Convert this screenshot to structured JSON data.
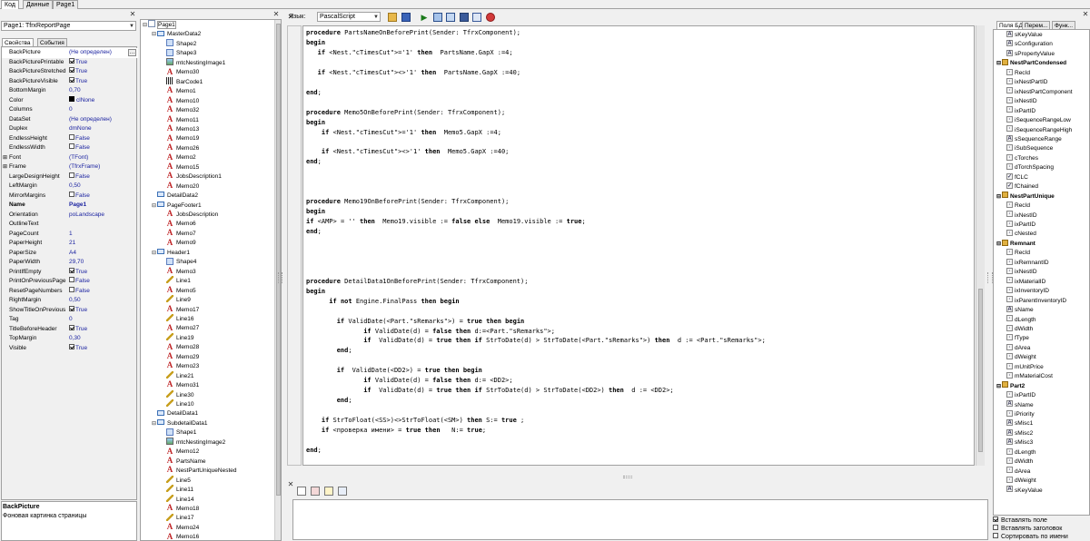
{
  "top_tabs": [
    "Код",
    "Данные",
    "Page1"
  ],
  "object_combo": "Page1: TfrxReportPage",
  "inspector_tabs": [
    "Свойства",
    "События"
  ],
  "properties": [
    {
      "name": "BackPicture",
      "value": "(Не определен)",
      "has_btn": true
    },
    {
      "name": "BackPicturePrintable",
      "value": "True",
      "check": true
    },
    {
      "name": "BackPictureStretched",
      "value": "True",
      "check": true
    },
    {
      "name": "BackPictureVisible",
      "value": "True",
      "check": true
    },
    {
      "name": "BottomMargin",
      "value": "0,70"
    },
    {
      "name": "Color",
      "value": "clNone",
      "swatch": "#000000"
    },
    {
      "name": "Columns",
      "value": "0"
    },
    {
      "name": "DataSet",
      "value": "(Не определен)"
    },
    {
      "name": "Duplex",
      "value": "dmNone"
    },
    {
      "name": "EndlessHeight",
      "value": "False",
      "check": false
    },
    {
      "name": "EndlessWidth",
      "value": "False",
      "check": false
    },
    {
      "name": "Font",
      "value": "(TFont)",
      "plus": true
    },
    {
      "name": "Frame",
      "value": "(TfrxFrame)",
      "plus": true
    },
    {
      "name": "LargeDesignHeight",
      "value": "False",
      "check": false
    },
    {
      "name": "LeftMargin",
      "value": "0,50"
    },
    {
      "name": "MirrorMargins",
      "value": "False",
      "check": false
    },
    {
      "name": "Name",
      "value": "Page1",
      "bold": true
    },
    {
      "name": "Orientation",
      "value": "poLandscape"
    },
    {
      "name": "OutlineText",
      "value": ""
    },
    {
      "name": "PageCount",
      "value": "1"
    },
    {
      "name": "PaperHeight",
      "value": "21"
    },
    {
      "name": "PaperSize",
      "value": "A4"
    },
    {
      "name": "PaperWidth",
      "value": "29,70"
    },
    {
      "name": "PrintIfEmpty",
      "value": "True",
      "check": true
    },
    {
      "name": "PrintOnPreviousPage",
      "value": "False",
      "check": false
    },
    {
      "name": "ResetPageNumbers",
      "value": "False",
      "check": false
    },
    {
      "name": "RightMargin",
      "value": "0,50"
    },
    {
      "name": "ShowTitleOnPrevious",
      "value": "True",
      "check": true
    },
    {
      "name": "Tag",
      "value": "0"
    },
    {
      "name": "TitleBeforeHeader",
      "value": "True",
      "check": true
    },
    {
      "name": "TopMargin",
      "value": "0,30"
    },
    {
      "name": "Visible",
      "value": "True",
      "check": true
    }
  ],
  "prop_hint": {
    "title": "BackPicture",
    "desc": "Фоновая картинка страницы"
  },
  "tree": [
    {
      "label": "Page1",
      "icon": "page",
      "level": 0,
      "exp": "-"
    },
    {
      "label": "MasterData2",
      "icon": "band",
      "level": 1,
      "exp": "-"
    },
    {
      "label": "Shape2",
      "icon": "shape",
      "level": 2
    },
    {
      "label": "Shape3",
      "icon": "shape",
      "level": 2
    },
    {
      "label": "mtcNestingImage1",
      "icon": "pic",
      "level": 2
    },
    {
      "label": "Memo30",
      "icon": "memo",
      "level": 2
    },
    {
      "label": "BarCode1",
      "icon": "bar",
      "level": 2
    },
    {
      "label": "Memo1",
      "icon": "memo",
      "level": 2
    },
    {
      "label": "Memo10",
      "icon": "memo",
      "level": 2
    },
    {
      "label": "Memo32",
      "icon": "memo",
      "level": 2
    },
    {
      "label": "Memo11",
      "icon": "memo",
      "level": 2
    },
    {
      "label": "Memo13",
      "icon": "memo",
      "level": 2
    },
    {
      "label": "Memo19",
      "icon": "memo",
      "level": 2
    },
    {
      "label": "Memo26",
      "icon": "memo",
      "level": 2
    },
    {
      "label": "Memo2",
      "icon": "memo",
      "level": 2
    },
    {
      "label": "Memo15",
      "icon": "memo",
      "level": 2
    },
    {
      "label": "JobsDescription1",
      "icon": "memo",
      "level": 2
    },
    {
      "label": "Memo20",
      "icon": "memo",
      "level": 2
    },
    {
      "label": "DetailData2",
      "icon": "band",
      "level": 1
    },
    {
      "label": "PageFooter1",
      "icon": "band",
      "level": 1,
      "exp": "-"
    },
    {
      "label": "JobsDescription",
      "icon": "memo",
      "level": 2
    },
    {
      "label": "Memo6",
      "icon": "memo",
      "level": 2
    },
    {
      "label": "Memo7",
      "icon": "memo",
      "level": 2
    },
    {
      "label": "Memo9",
      "icon": "memo",
      "level": 2
    },
    {
      "label": "Header1",
      "icon": "band",
      "level": 1,
      "exp": "-"
    },
    {
      "label": "Shape4",
      "icon": "shape",
      "level": 2
    },
    {
      "label": "Memo3",
      "icon": "memo",
      "level": 2
    },
    {
      "label": "Line1",
      "icon": "line",
      "level": 2
    },
    {
      "label": "Memo5",
      "icon": "memo",
      "level": 2
    },
    {
      "label": "Line9",
      "icon": "line",
      "level": 2
    },
    {
      "label": "Memo17",
      "icon": "memo",
      "level": 2
    },
    {
      "label": "Line16",
      "icon": "line",
      "level": 2
    },
    {
      "label": "Memo27",
      "icon": "memo",
      "level": 2
    },
    {
      "label": "Line19",
      "icon": "line",
      "level": 2
    },
    {
      "label": "Memo28",
      "icon": "memo",
      "level": 2
    },
    {
      "label": "Memo29",
      "icon": "memo",
      "level": 2
    },
    {
      "label": "Memo23",
      "icon": "memo",
      "level": 2
    },
    {
      "label": "Line21",
      "icon": "line",
      "level": 2
    },
    {
      "label": "Memo31",
      "icon": "memo",
      "level": 2
    },
    {
      "label": "Line30",
      "icon": "line",
      "level": 2
    },
    {
      "label": "Line10",
      "icon": "line",
      "level": 2
    },
    {
      "label": "DetailData1",
      "icon": "band",
      "level": 1
    },
    {
      "label": "SubdetailData1",
      "icon": "band",
      "level": 1,
      "exp": "-"
    },
    {
      "label": "Shape1",
      "icon": "shape",
      "level": 2
    },
    {
      "label": "mtcNestingImage2",
      "icon": "pic",
      "level": 2
    },
    {
      "label": "Memo12",
      "icon": "memo",
      "level": 2
    },
    {
      "label": "PartsName",
      "icon": "memo",
      "level": 2
    },
    {
      "label": "NestPartUniqueNested",
      "icon": "memo",
      "level": 2
    },
    {
      "label": "Line5",
      "icon": "line",
      "level": 2
    },
    {
      "label": "Line11",
      "icon": "line",
      "level": 2
    },
    {
      "label": "Line14",
      "icon": "line",
      "level": 2
    },
    {
      "label": "Memo18",
      "icon": "memo",
      "level": 2
    },
    {
      "label": "Line17",
      "icon": "line",
      "level": 2
    },
    {
      "label": "Memo24",
      "icon": "memo",
      "level": 2
    },
    {
      "label": "Memo16",
      "icon": "memo",
      "level": 2
    }
  ],
  "toolbar": {
    "lang_label": "Язык:",
    "lang_value": "PascalScript"
  },
  "code_lines": [
    "procedure PartsNameOnBeforePrint(Sender: TfrxComponent);",
    "begin",
    "   if <Nest.\"cTimesCut\">='1' then  PartsName.GapX :=4;",
    "",
    "   if <Nest.\"cTimesCut\"><>'1' then  PartsName.GapX :=40;",
    "",
    "end;",
    "",
    "procedure Memo5OnBeforePrint(Sender: TfrxComponent);",
    "begin",
    "    if <Nest.\"cTimesCut\">='1' then  Memo5.GapX :=4;",
    "",
    "    if <Nest.\"cTimesCut\"><>'1' then  Memo5.GapX :=40;",
    "end;",
    "",
    "",
    "",
    "procedure Memo19OnBeforePrint(Sender: TfrxComponent);",
    "begin",
    "if <AMP> = '' then  Memo19.visible := false else  Memo19.visible := true;",
    "end;",
    "",
    "",
    "",
    "",
    "procedure DetailData1OnBeforePrint(Sender: TfrxComponent);",
    "begin",
    "      if not Engine.FinalPass then begin",
    "",
    "        if ValidDate(<Part.\"sRemarks\">) = true then begin",
    "               if ValidDate(d) = false then d:=<Part.\"sRemarks\">;",
    "               if  ValidDate(d) = true then if StrToDate(d) > StrToDate(<Part.\"sRemarks\">) then  d := <Part.\"sRemarks\">;",
    "        end;",
    "",
    "        if  ValidDate(<DD2>) = true then begin",
    "               if ValidDate(d) = false then d:= <DD2>;",
    "               if  ValidDate(d) = true then if StrToDate(d) > StrToDate(<DD2>) then  d := <DD2>;",
    "        end;",
    "",
    "    if StrToFloat(<SS>)<>StrToFloat(<SM>) then S:= true ;",
    "    if <проверка имени> = true then   N:= true;",
    "",
    "end;"
  ],
  "right_tabs": [
    "Поля БД",
    "Перем...",
    "Функ..."
  ],
  "fields": [
    {
      "label": "sKeyValue",
      "type": "A"
    },
    {
      "label": "sConfiguration",
      "type": "A"
    },
    {
      "label": "sPropertyValue",
      "type": "A"
    },
    {
      "label": "NestPartCondensed",
      "group": true
    },
    {
      "label": "RecId",
      "type": "#"
    },
    {
      "label": "ixNestPartID",
      "type": "#"
    },
    {
      "label": "ixNestPartComponent",
      "type": "#"
    },
    {
      "label": "ixNestID",
      "type": "#"
    },
    {
      "label": "ixPartID",
      "type": "#"
    },
    {
      "label": "iSequenceRangeLow",
      "type": "#"
    },
    {
      "label": "iSequenceRangeHigh",
      "type": "#"
    },
    {
      "label": "sSequenceRange",
      "type": "A"
    },
    {
      "label": "iSubSequence",
      "type": "#"
    },
    {
      "label": "cTorches",
      "type": "#"
    },
    {
      "label": "dTorchSpacing",
      "type": "#"
    },
    {
      "label": "fCLC",
      "type": "v"
    },
    {
      "label": "fChained",
      "type": "v"
    },
    {
      "label": "NestPartUnique",
      "group": true
    },
    {
      "label": "RecId",
      "type": "#"
    },
    {
      "label": "ixNestID",
      "type": "#"
    },
    {
      "label": "ixPartID",
      "type": "#"
    },
    {
      "label": "cNested",
      "type": "#"
    },
    {
      "label": "Remnant",
      "group": true
    },
    {
      "label": "RecId",
      "type": "#"
    },
    {
      "label": "ixRemnantID",
      "type": "#"
    },
    {
      "label": "ixNestID",
      "type": "#"
    },
    {
      "label": "ixMaterialID",
      "type": "#"
    },
    {
      "label": "ixInventoryID",
      "type": "#"
    },
    {
      "label": "ixParentInventoryID",
      "type": "#"
    },
    {
      "label": "sName",
      "type": "A"
    },
    {
      "label": "dLength",
      "type": "#"
    },
    {
      "label": "dWidth",
      "type": "#"
    },
    {
      "label": "fType",
      "type": "#"
    },
    {
      "label": "dArea",
      "type": "#"
    },
    {
      "label": "dWeight",
      "type": "#"
    },
    {
      "label": "mUnitPrice",
      "type": "#"
    },
    {
      "label": "mMaterialCost",
      "type": "#"
    },
    {
      "label": "Part2",
      "group": true
    },
    {
      "label": "ixPartID",
      "type": "#"
    },
    {
      "label": "sName",
      "type": "A"
    },
    {
      "label": "iPriority",
      "type": "#"
    },
    {
      "label": "sMisc1",
      "type": "A"
    },
    {
      "label": "sMisc2",
      "type": "A"
    },
    {
      "label": "sMisc3",
      "type": "A"
    },
    {
      "label": "dLength",
      "type": "#"
    },
    {
      "label": "dWidth",
      "type": "#"
    },
    {
      "label": "dArea",
      "type": "#"
    },
    {
      "label": "dWeight",
      "type": "#"
    },
    {
      "label": "sKeyValue",
      "type": "A"
    }
  ],
  "field_options": [
    {
      "label": "Вставлять поле",
      "checked": true
    },
    {
      "label": "Вставлять заголовок",
      "checked": false
    },
    {
      "label": "Сортировать по имени",
      "checked": false
    }
  ]
}
